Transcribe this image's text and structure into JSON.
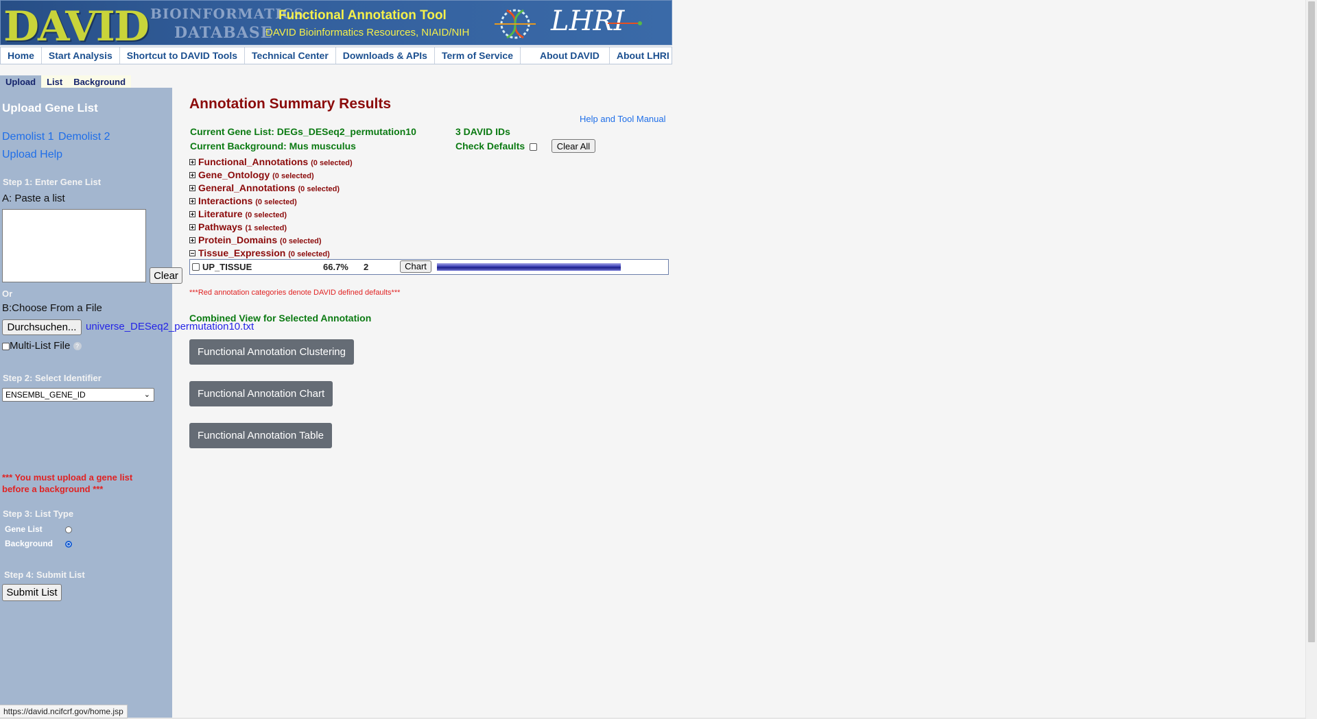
{
  "header": {
    "logo_text": "DAVID",
    "logo_sub1": "BIOINFORMATICS",
    "logo_sub2": "DATABASE",
    "title": "Functional Annotation Tool",
    "subtitle": "DAVID Bioinformatics Resources, NIAID/NIH",
    "partner_logo": "LHRI"
  },
  "nav": {
    "items": [
      "Home",
      "Start Analysis",
      "Shortcut to DAVID Tools",
      "Technical Center",
      "Downloads & APIs",
      "Term of Service",
      "About DAVID",
      "About LHRI"
    ]
  },
  "left": {
    "tabs": [
      "Upload",
      "List",
      "Background"
    ],
    "active_tab": "Upload",
    "title": "Upload Gene List",
    "demolist1": "Demolist 1",
    "demolist2": "Demolist 2",
    "upload_help": "Upload Help",
    "step1": "Step 1: Enter Gene List",
    "paste_label": "A: Paste a list",
    "clear_button": "Clear",
    "or_label": "Or",
    "file_label": "B:Choose From a File",
    "browse_button": "Durchsuchen...",
    "file_name": "universe_DESeq2_permutation10.txt",
    "multilist_label": "Multi-List File",
    "help_glyph": "?",
    "step2": "Step 2: Select Identifier",
    "identifier_value": "ENSEMBL_GENE_ID",
    "warning_line1": "*** You must upload a gene list",
    "warning_line2": "before a background ***",
    "step3": "Step 3: List Type",
    "gene_list_label": "Gene List",
    "background_label": "Background",
    "list_type_selected": "Background",
    "step4": "Step 4: Submit List",
    "submit_button": "Submit List"
  },
  "main": {
    "title": "Annotation Summary Results",
    "help_link": "Help and Tool Manual",
    "current_gene_list": "Current Gene List: DEGs_DESeq2_permutation10",
    "david_ids": "3 DAVID IDs",
    "current_background": "Current Background: Mus musculus",
    "check_defaults": "Check Defaults",
    "clear_all": "Clear All",
    "categories": [
      {
        "name": "Functional_Annotations",
        "selected": "(0 selected)"
      },
      {
        "name": "Gene_Ontology",
        "selected": "(0 selected)"
      },
      {
        "name": "General_Annotations",
        "selected": "(0 selected)"
      },
      {
        "name": "Interactions",
        "selected": "(0 selected)"
      },
      {
        "name": "Literature",
        "selected": "(0 selected)"
      },
      {
        "name": "Pathways",
        "selected": "(1 selected)"
      },
      {
        "name": "Protein_Domains",
        "selected": "(0 selected)"
      },
      {
        "name": "Tissue_Expression",
        "selected": "(0 selected)"
      }
    ],
    "tissue_row": {
      "name": "UP_TISSUE",
      "percent": "66.7%",
      "count": "2",
      "chart_button": "Chart",
      "bar_fraction": 0.667
    },
    "defaults_note": "***Red annotation categories denote DAVID defined defaults***",
    "combined_title": "Combined View for Selected Annotation",
    "buttons": [
      "Functional Annotation Clustering",
      "Functional Annotation Chart",
      "Functional Annotation Table"
    ]
  },
  "status_url": "https://david.ncifcrf.gov/home.jsp",
  "colors": {
    "banner": "#335f9c",
    "left_panel": "#a3b6cf",
    "accent_red": "#8b0b0b",
    "accent_green": "#0b7a12",
    "title_yellow": "#f5f04a"
  }
}
